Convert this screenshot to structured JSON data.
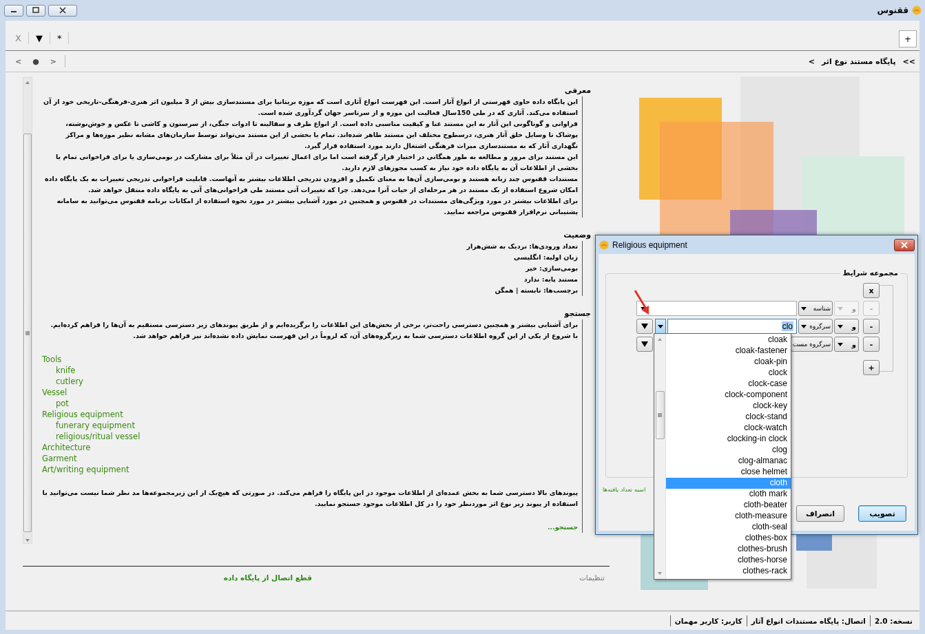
{
  "window": {
    "title": "ققنوس"
  },
  "toolbar": {
    "buttons": [
      {
        "label": "*",
        "disabled": false
      },
      {
        "label": "▼",
        "disabled": false
      },
      {
        "label": "X",
        "disabled": true
      }
    ],
    "new_tab": "+"
  },
  "nav": {
    "buttons": [
      ">",
      "●",
      "<"
    ],
    "breadcrumb": [
      ">>",
      "پایگاه مستند نوع اثر",
      ">"
    ]
  },
  "sections": [
    {
      "kind": "paragraphs",
      "title": "معرفی",
      "paragraphs": [
        "این پایگاه داده حاوی فهرستی از انواع آثار است. این فهرست انواع آثاری است که موزه بریتانیا برای مستندسازی بیش از 3 میلیون اثر هنری-فرهنگی-تاریخی خود از آن استفاده می‌کند. آثاری که در طی 150سال فعالیت این موزه و از سرتاسر جهان گردآوری شده است.",
        "فراوانی و گوناگونی این آثار به این مستند غنا و کیفیت مناسبی داده است. از انواع ظرف و سفالینه تا ادوات جنگی، از سرستون و کاشی تا عکس و خوش‌نوشته، پوشاک تا وسایل خلق آثار هنری، درسطوح مختلف این مستند ظاهر شده‌اند. تمام یا بخشی از این مستند می‌تواند توسط سازمان‌های مشابه نظیر موزه‌ها و مراکز نگهداری آثار که به مستندسازی میراث فرهنگی اشتغال دارند مورد استفاده قرار گیرد.",
        "این مستند برای مرور و مطالعه به طور همگانی در اختیار قرار گرفته است اما برای اعمال تغییرات در آن مثلاً برای مشارکت در بومی‌سازی یا برای فراخوانی تمام یا بخشی از اطلاعات آن به پایگاه داده خود نیاز به کسب مجوزهای لازم دارید.",
        "مستندات ققنوس چند زبانه هستند و بومی‌سازی آن‌ها به معنای تکمیل و افزودن تدریجی اطلاعات بیشتر به آنهاست. قابلیت فراخوانی تدریجی تغییرات به یک پایگاه داده امکان شروع استفاده از یک مستند در هر مرحله‌ای از حیات آنرا می‌دهد. چرا که تغییرات آتی مستند طی فراخوانی‌های آتی به پایگاه داده منتقل خواهد شد.",
        "برای اطلاعات بیشتر در مورد ویژگی‌های مستندات در ققنوس و همچنین در مورد آشنایی بیشتر در مورد نحوه استفاده از امکانات برنامه ققنوس می‌توانید به سامانه پشتیبانی نرم‌افزار ققنوس مراجعه نمایید."
      ]
    },
    {
      "kind": "lines",
      "title": "وضعیت",
      "lines": [
        "تعداد ورودی‌ها: نزدیک به شش‌هزار",
        "زبان اولیه: انگلیسی",
        "بومی‌سازی: خیر",
        "مستند پایه: ندارد",
        "برچسب‌ها: نابسته | همگن"
      ]
    },
    {
      "kind": "search",
      "title": "جستجو",
      "intro": [
        "برای آشنایی بیشتر و همچنین دسترسی راحت‌تر، برخی از بخش‌های این اطلاعات را برگزیده‌ایم و از طریق پیوندهای زیر دسترسی مستقیم به آن‌ها را فراهم کرده‌ایم.",
        "با شروع از یکی از این گروه اطلاعات دسترسی شما به زیرگروه‌های آن، که لزوماً در این فهرست نمایش داده نشده‌اند نیز فراهم خواهد شد."
      ],
      "tree": [
        {
          "label": "Tools",
          "children": [
            {
              "label": "knife"
            },
            {
              "label": "cutlery"
            }
          ]
        },
        {
          "label": "Vessel",
          "children": [
            {
              "label": "pot"
            }
          ]
        },
        {
          "label": "Religious equipment",
          "children": [
            {
              "label": "funerary equipment"
            },
            {
              "label": "religious/ritual vessel"
            }
          ]
        },
        {
          "label": "Architecture"
        },
        {
          "label": "Garment"
        },
        {
          "label": "Art/writing equipment"
        }
      ],
      "note": "پیوندهای بالا دسترسی شما به بخش عمده‌ای از اطلاعات موجود در این پایگاه را فراهم می‌کند. در صورتی که هیچ‌یک از این زیرمجموعه‌ها مد نظر شما نیست می‌توانید با استفاده از پیوند زیر نوع اثر موردنظر خود را در کل اطلاعات موجود جستجو نمایید.",
      "link": "جستجو..."
    }
  ],
  "footer": {
    "settings": "تنظیمات",
    "disconnect": "قطع اتصال از پایگاه داده"
  },
  "status_bar": [
    "نسخه: 2.0",
    "اتصال: پایگاه مستندات انواع آثار",
    "کاربر: کاربر مهمان"
  ],
  "dialog": {
    "title": "Religious equipment",
    "group_title": "مجموعه شرایط",
    "clear": "x",
    "conditions": [
      {
        "kind": "combo",
        "remove": "-",
        "disabled": true,
        "operator": "و",
        "field": "شناسه",
        "open": false
      },
      {
        "kind": "text",
        "remove": "-",
        "disabled": false,
        "operator": "و",
        "field": "سرگروه",
        "value": "clo",
        "open": true
      },
      {
        "kind": "covered",
        "remove": "-",
        "disabled": false,
        "operator": "و",
        "field": "سرگروه مست",
        "open": false
      }
    ],
    "add": "+",
    "count_link": "اسبه تعداد یافته‌ها",
    "buttons": [
      {
        "label": "تصویب",
        "default": true
      },
      {
        "label": "انصراف",
        "default": false
      }
    ]
  },
  "dropdown": {
    "items": [
      {
        "label": "cloak",
        "selected": false
      },
      {
        "label": "cloak-fastener",
        "selected": false
      },
      {
        "label": "cloak-pin",
        "selected": false
      },
      {
        "label": "clock",
        "selected": false
      },
      {
        "label": "clock-case",
        "selected": false
      },
      {
        "label": "clock-component",
        "selected": false
      },
      {
        "label": "clock-key",
        "selected": false
      },
      {
        "label": "clock-stand",
        "selected": false
      },
      {
        "label": "clock-watch",
        "selected": false
      },
      {
        "label": "clocking-in clock",
        "selected": false
      },
      {
        "label": "clog",
        "selected": false
      },
      {
        "label": "clog-almanac",
        "selected": false
      },
      {
        "label": "close helmet",
        "selected": false
      },
      {
        "label": "cloth",
        "selected": true
      },
      {
        "label": "cloth mark",
        "selected": false
      },
      {
        "label": "cloth-beater",
        "selected": false
      },
      {
        "label": "cloth-measure",
        "selected": false
      },
      {
        "label": "cloth-seal",
        "selected": false
      },
      {
        "label": "clothes-box",
        "selected": false
      },
      {
        "label": "clothes-brush",
        "selected": false
      },
      {
        "label": "clothes-horse",
        "selected": false
      },
      {
        "label": "clothes-rack",
        "selected": false
      }
    ]
  }
}
